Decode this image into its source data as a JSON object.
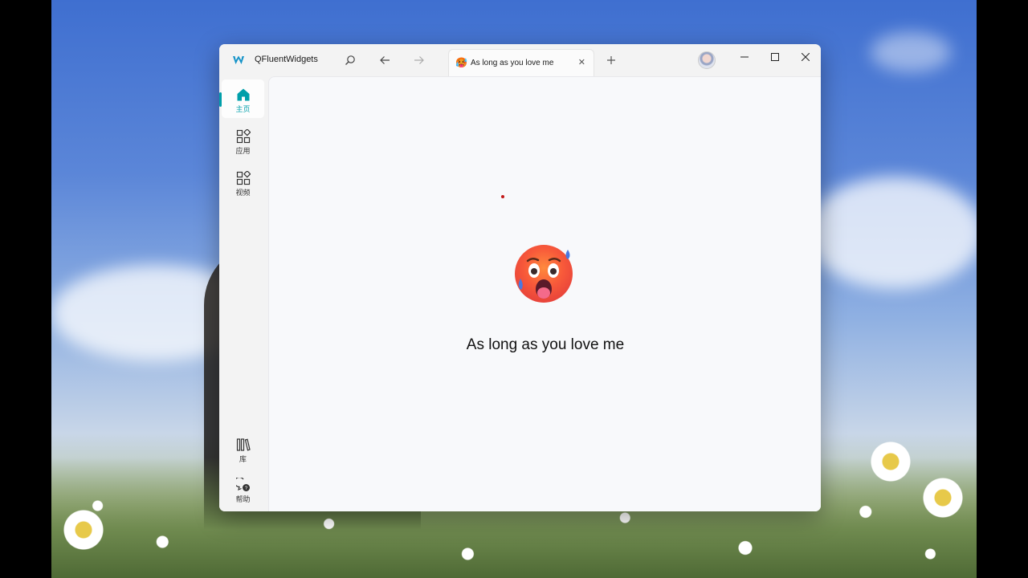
{
  "window": {
    "app_title": "QFluentWidgets",
    "tab_label": "As long as you love me",
    "tab_icon": "hot-face-emoji"
  },
  "toolbar": {
    "search_icon": "search-icon",
    "back_icon": "arrow-left-icon",
    "forward_icon": "arrow-right-icon",
    "add_tab_icon": "plus-icon",
    "close_tab_icon": "close-icon"
  },
  "window_controls": {
    "minimize": "minimize-icon",
    "maximize": "maximize-icon",
    "close": "close-icon"
  },
  "sidebar": {
    "items": [
      {
        "label": "主页",
        "icon": "home-icon",
        "active": true
      },
      {
        "label": "应用",
        "icon": "apps-icon",
        "active": false
      },
      {
        "label": "视频",
        "icon": "apps-icon",
        "active": false
      }
    ],
    "bottom_items": [
      {
        "label": "库",
        "icon": "library-icon"
      },
      {
        "label": "帮助",
        "icon": "help-icon"
      }
    ]
  },
  "main": {
    "message": "As long as you love me",
    "emoji": "hot-face-emoji"
  },
  "colors": {
    "accent": "#009faa",
    "window_bg": "#f3f3f3",
    "content_bg": "#f8f9fb"
  }
}
